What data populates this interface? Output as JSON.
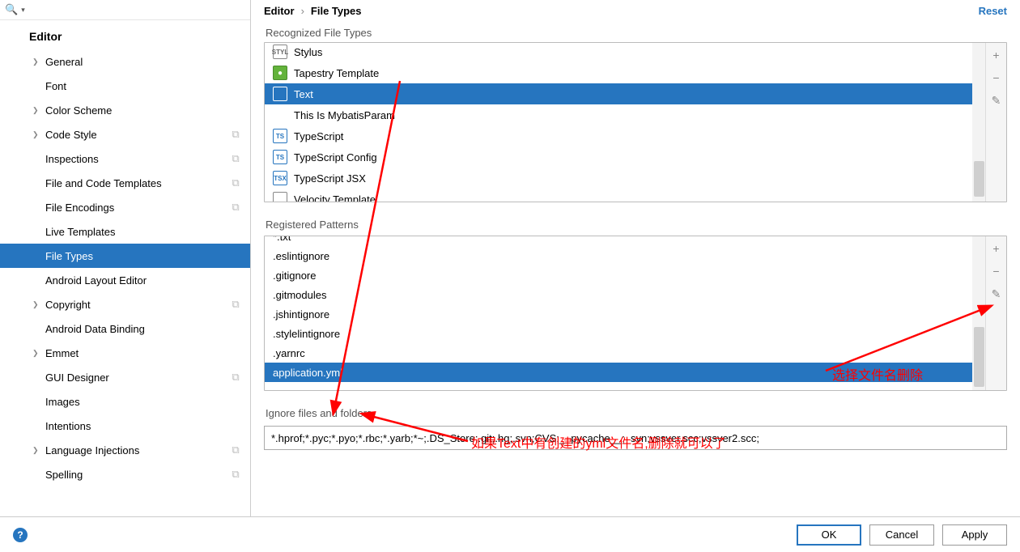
{
  "search": {
    "placeholder": ""
  },
  "tree": {
    "header": "Editor",
    "items": [
      {
        "label": "General",
        "arrow": true,
        "badge": false
      },
      {
        "label": "Font",
        "arrow": false,
        "badge": false
      },
      {
        "label": "Color Scheme",
        "arrow": true,
        "badge": false
      },
      {
        "label": "Code Style",
        "arrow": true,
        "badge": true
      },
      {
        "label": "Inspections",
        "arrow": false,
        "badge": true
      },
      {
        "label": "File and Code Templates",
        "arrow": false,
        "badge": true
      },
      {
        "label": "File Encodings",
        "arrow": false,
        "badge": true
      },
      {
        "label": "Live Templates",
        "arrow": false,
        "badge": false
      },
      {
        "label": "File Types",
        "arrow": false,
        "badge": false,
        "selected": true
      },
      {
        "label": "Android Layout Editor",
        "arrow": false,
        "badge": false
      },
      {
        "label": "Copyright",
        "arrow": true,
        "badge": true
      },
      {
        "label": "Android Data Binding",
        "arrow": false,
        "badge": false
      },
      {
        "label": "Emmet",
        "arrow": true,
        "badge": false
      },
      {
        "label": "GUI Designer",
        "arrow": false,
        "badge": true
      },
      {
        "label": "Images",
        "arrow": false,
        "badge": false
      },
      {
        "label": "Intentions",
        "arrow": false,
        "badge": false
      },
      {
        "label": "Language Injections",
        "arrow": true,
        "badge": true
      },
      {
        "label": "Spelling",
        "arrow": false,
        "badge": true
      }
    ]
  },
  "breadcrumb": {
    "root": "Editor",
    "current": "File Types",
    "reset": "Reset"
  },
  "sections": {
    "types_label": "Recognized File Types",
    "patterns_label": "Registered Patterns",
    "ignore_label": "Ignore files and folders"
  },
  "file_types": [
    {
      "icon": "STYL",
      "cls": "",
      "label": "Stylus"
    },
    {
      "icon": "●",
      "cls": "green",
      "label": "Tapestry Template"
    },
    {
      "icon": "",
      "cls": "txt",
      "label": "Text",
      "selected": true
    },
    {
      "icon": "",
      "cls": "none",
      "label": "This Is MybatisParam"
    },
    {
      "icon": "TS",
      "cls": "ts",
      "label": "TypeScript"
    },
    {
      "icon": "TS",
      "cls": "ts",
      "label": "TypeScript Config"
    },
    {
      "icon": "TSX",
      "cls": "ts",
      "label": "TypeScript JSX"
    },
    {
      "icon": "",
      "cls": "",
      "label": "Velocity Template"
    }
  ],
  "patterns": [
    {
      "label": "*.txt"
    },
    {
      "label": ".eslintignore"
    },
    {
      "label": ".gitignore"
    },
    {
      "label": ".gitmodules"
    },
    {
      "label": ".jshintignore"
    },
    {
      "label": ".stylelintignore"
    },
    {
      "label": ".yarnrc"
    },
    {
      "label": "application.yml",
      "selected": true
    }
  ],
  "ignore_value": "*.hprof;*.pyc;*.pyo;*.rbc;*.yarb;*~;.DS_Store;.git;.hg;.svn;CVS;__pycache__;_svn;vssver.scc;vssver2.scc;",
  "footer": {
    "ok": "OK",
    "cancel": "Cancel",
    "apply": "Apply"
  },
  "annotations": {
    "text1": "如果Text中有创建的yml文件名,删除就可以了",
    "text2": "选择文件名删除"
  }
}
